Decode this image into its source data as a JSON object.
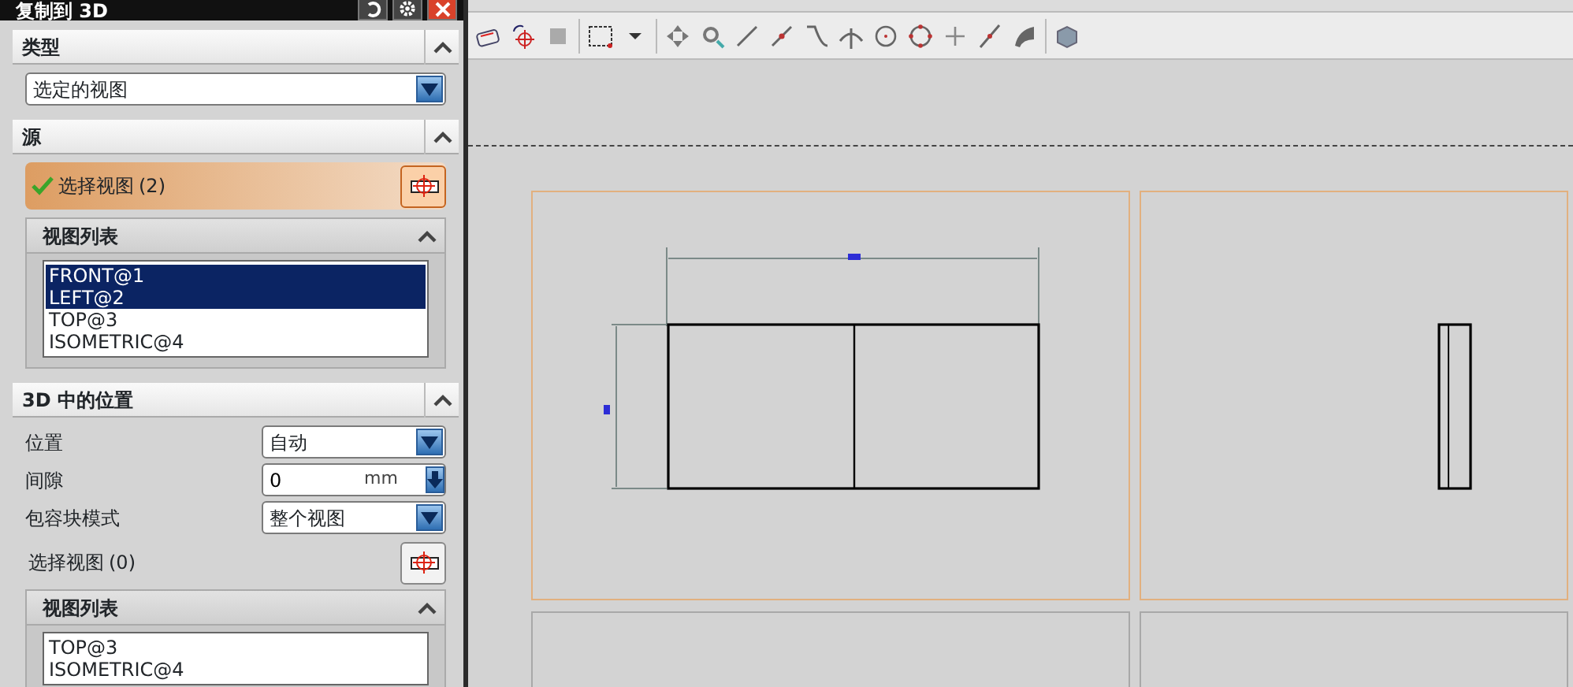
{
  "window": {
    "title": "复制到 3D"
  },
  "type_section": {
    "title": "类型",
    "expanded": true,
    "dropdown": {
      "value": "选定的视图"
    }
  },
  "source_section": {
    "title": "源",
    "expanded": true,
    "select_views": {
      "label": "选择视图",
      "count": "(2)",
      "done": true,
      "active": true
    },
    "view_list": {
      "title": "视图列表",
      "expanded": true,
      "items": [
        {
          "label": "FRONT@1",
          "selected": true
        },
        {
          "label": "LEFT@2",
          "selected": true
        },
        {
          "label": "TOP@3",
          "selected": false
        },
        {
          "label": "ISOMETRIC@4",
          "selected": false
        }
      ]
    }
  },
  "position_section": {
    "title": "3D 中的位置",
    "expanded": true,
    "fields": [
      {
        "kind": "dropdown",
        "label": "位置",
        "value": "自动"
      },
      {
        "kind": "number",
        "label": "间隙",
        "value": "0",
        "unit": "mm"
      },
      {
        "kind": "dropdown",
        "label": "包容块模式",
        "value": "整个视图"
      }
    ],
    "select_views": {
      "label": "选择视图",
      "count": "(0)",
      "done": false,
      "active": false
    },
    "view_list": {
      "title": "视图列表",
      "expanded": true,
      "items": [
        {
          "label": "TOP@3",
          "selected": false
        },
        {
          "label": "ISOMETRIC@4",
          "selected": false
        }
      ]
    }
  }
}
